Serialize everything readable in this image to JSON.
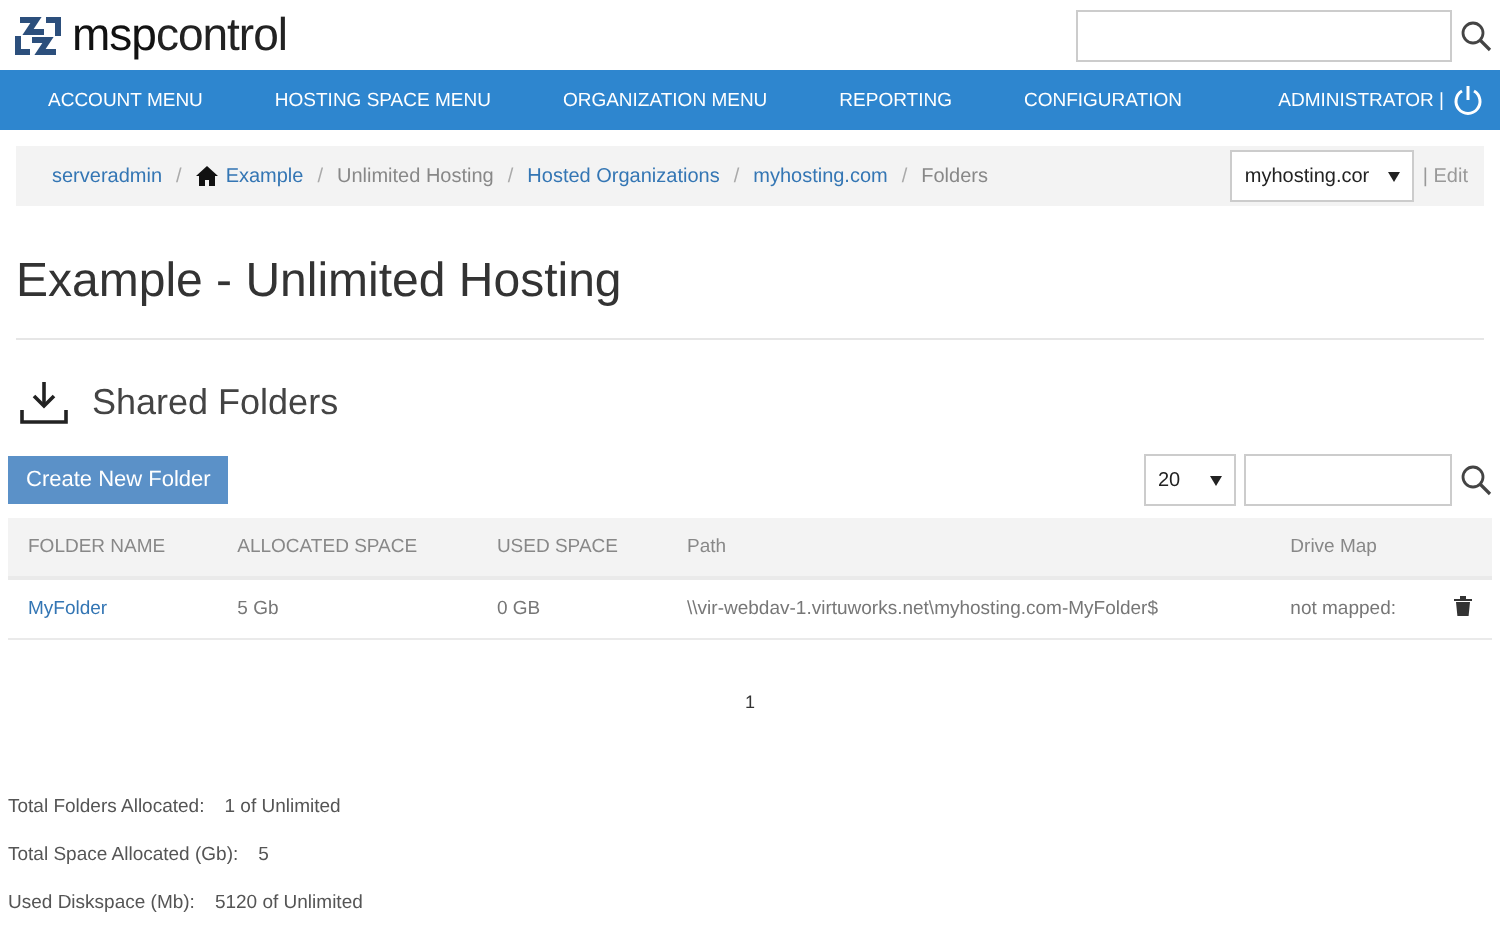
{
  "header": {
    "logo": "**msp**control"
  },
  "nav": {
    "items": [
      "ACCOUNT MENU",
      "HOSTING SPACE MENU",
      "ORGANIZATION MENU",
      "REPORTING",
      "CONFIGURATION"
    ],
    "user": "ADMINISTRATOR |"
  },
  "breadcrumb": {
    "items": [
      {
        "label": "serveradmin",
        "kind": "link"
      },
      {
        "label": "Example",
        "kind": "home"
      },
      {
        "label": "Unlimited Hosting",
        "kind": "text"
      },
      {
        "label": "Hosted Organizations",
        "kind": "link"
      },
      {
        "label": "myhosting.com",
        "kind": "link"
      },
      {
        "label": "Folders",
        "kind": "text"
      }
    ],
    "separator": "/",
    "org_select": "myhosting.cor",
    "edit": "| Edit"
  },
  "page_title": "Example - Unlimited Hosting",
  "section_title": "Shared Folders",
  "toolbar": {
    "create_button": "Create New Folder",
    "page_size": "20"
  },
  "table": {
    "columns": [
      "FOLDER NAME",
      "ALLOCATED SPACE",
      "USED SPACE",
      "Path",
      "Drive Map"
    ],
    "rows": [
      {
        "name": "MyFolder",
        "allocated": "5 Gb",
        "used": "0 GB",
        "path": "\\\\vir-webdav-1.virtuworks.net\\myhosting.com-MyFolder$",
        "drive_map": "not mapped:"
      }
    ]
  },
  "pager": [
    "1"
  ],
  "summary": [
    {
      "label": "Total Folders Allocated:",
      "value": "1 of Unlimited"
    },
    {
      "label": "Total Space Allocated (Gb):",
      "value": "5"
    },
    {
      "label": "Used Diskspace (Mb):",
      "value": "5120 of Unlimited"
    }
  ]
}
